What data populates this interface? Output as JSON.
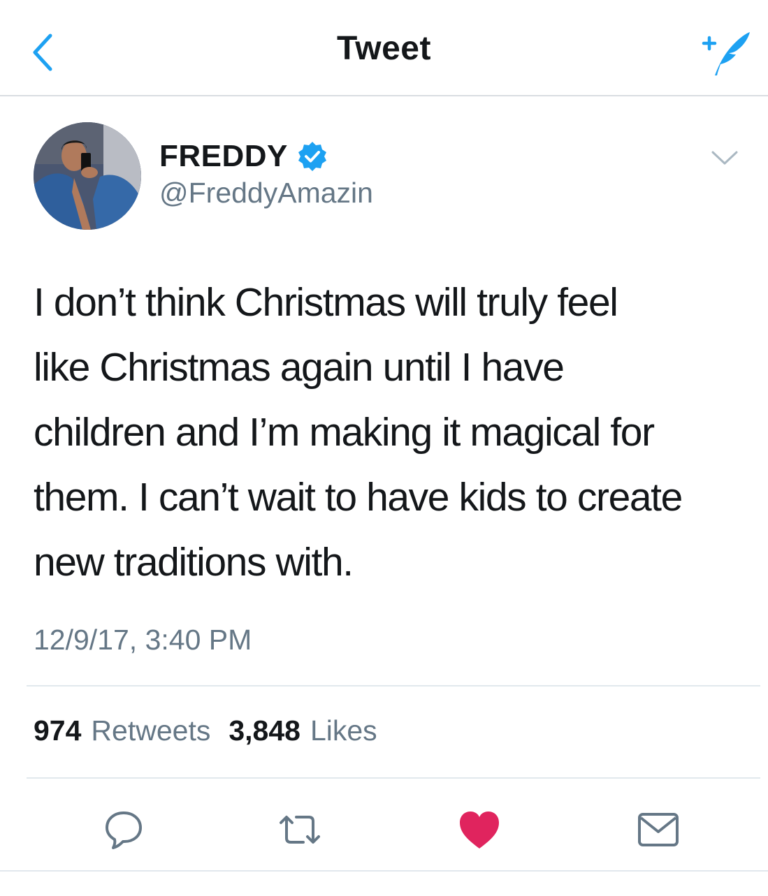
{
  "nav": {
    "title": "Tweet",
    "back_icon": "chevron-left-icon",
    "compose_icon": "compose-tweet-icon",
    "accent_color": "#1da1f2"
  },
  "author": {
    "name": "FREDDY",
    "handle": "@FreddyAmazin",
    "verified": true,
    "verified_color": "#1da1f2"
  },
  "tweet": {
    "lines": [
      "I don’t think Christmas will truly feel",
      "like Christmas again until I have",
      "children and I’m making it magical for",
      "them. I can’t wait to have kids to create",
      "new traditions with."
    ],
    "timestamp": "12/9/17, 3:40 PM"
  },
  "stats": {
    "retweets_count": "974",
    "retweets_label": "Retweets",
    "likes_count": "3,848",
    "likes_label": "Likes"
  },
  "actions": {
    "reply_icon": "reply-icon",
    "retweet_icon": "retweet-icon",
    "like_icon": "heart-icon",
    "like_active": true,
    "like_color": "#e0245e",
    "dm_icon": "envelope-icon",
    "icon_color": "#657786"
  }
}
